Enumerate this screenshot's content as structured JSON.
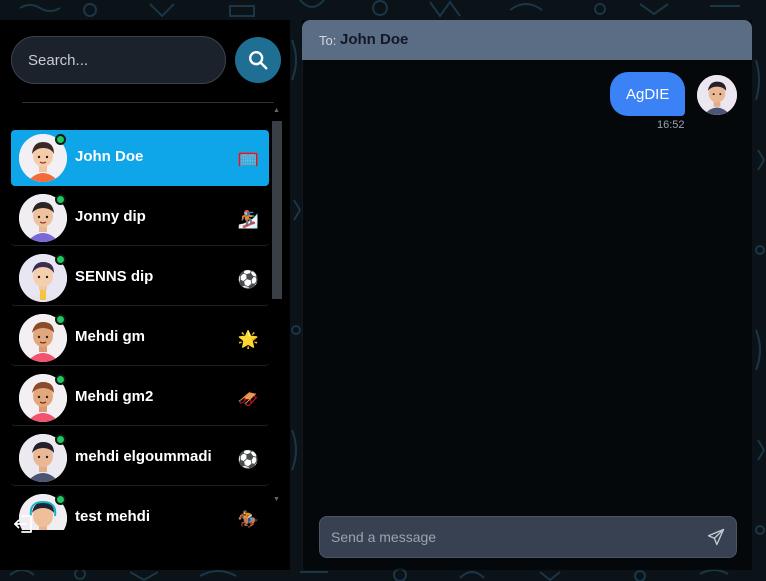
{
  "search": {
    "placeholder": "Search..."
  },
  "contacts": [
    {
      "name": "John Doe",
      "emoji": "🥅",
      "online": true,
      "active": true
    },
    {
      "name": "Jonny dip",
      "emoji": "🏂",
      "online": true,
      "active": false
    },
    {
      "name": "SENNS dip",
      "emoji": "⚽",
      "online": true,
      "active": false
    },
    {
      "name": "Mehdi gm",
      "emoji": "🌟",
      "online": true,
      "active": false
    },
    {
      "name": "Mehdi gm2",
      "emoji": "🛷",
      "online": true,
      "active": false
    },
    {
      "name": "mehdi elgoummadi",
      "emoji": "⚽",
      "online": true,
      "active": false
    },
    {
      "name": "test mehdi",
      "emoji": "🏇",
      "online": true,
      "active": false
    }
  ],
  "chat": {
    "to_label": "To:",
    "to_name": "John Doe",
    "messages": [
      {
        "text": "AgDIE",
        "time": "16:52",
        "outgoing": true
      }
    ]
  },
  "composer": {
    "placeholder": "Send a message"
  },
  "colors": {
    "active_contact": "#0ea5e9",
    "online": "#22c55e",
    "outgoing_bubble": "#3b82f6",
    "header": "#5b6c85",
    "search_button": "#1e6f93"
  },
  "icons": {
    "search": "search-icon",
    "send": "send-icon",
    "logout": "logout-icon"
  }
}
